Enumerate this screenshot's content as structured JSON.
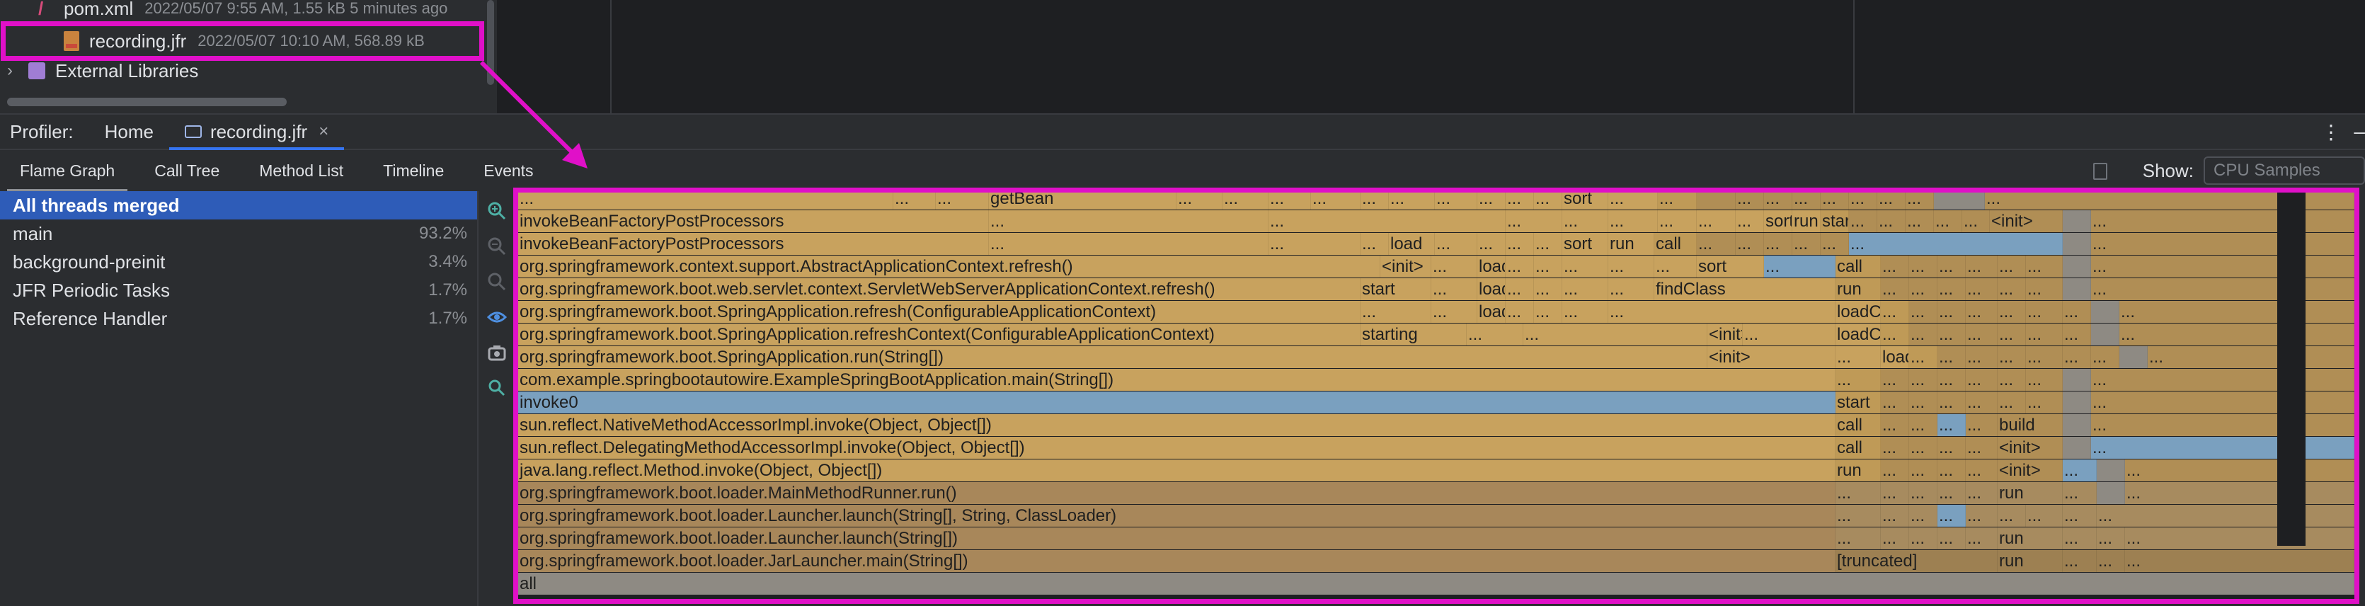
{
  "project_tree": {
    "items": [
      {
        "name": "pom.xml",
        "meta": "2022/05/07 9:55 AM, 1.55 kB 5 minutes ago"
      },
      {
        "name": "recording.jfr",
        "meta": "2022/05/07 10:10 AM, 568.89 kB"
      },
      {
        "name": "External Libraries",
        "meta": ""
      }
    ]
  },
  "profiler": {
    "label": "Profiler:",
    "tabs": [
      {
        "label": "Home"
      },
      {
        "label": "recording.jfr",
        "closable": true
      }
    ],
    "close_glyph": "×",
    "menu_glyph": "⋮",
    "minimize_glyph": "–"
  },
  "sub_tabs": [
    "Flame Graph",
    "Call Tree",
    "Method List",
    "Timeline",
    "Events"
  ],
  "show": {
    "label": "Show:",
    "value": "CPU Samples"
  },
  "threads": [
    {
      "name": "All threads merged",
      "pct": ""
    },
    {
      "name": "main",
      "pct": "93.2%"
    },
    {
      "name": "background-preinit",
      "pct": "3.4%"
    },
    {
      "name": "JFR Periodic Tasks",
      "pct": "1.7%"
    },
    {
      "name": "Reference Handler",
      "pct": "1.7%"
    }
  ],
  "toolbar_icons": [
    "zoom-in-icon",
    "zoom-out-icon",
    "zoom-reset-icon",
    "eye-icon",
    "camera-icon",
    "search-icon"
  ],
  "colors": {
    "highlight": "#e010c8",
    "frame_main": "#c8a25e",
    "frame_selected": "#7aa0bf",
    "frame_root": "#8e8a83",
    "active_tab": "#3574f0",
    "thread_selected": "#2e5cb8"
  },
  "flame_rows": [
    {
      "frames": [
        [
          "...",
          "c1"
        ],
        [
          "...",
          "c1"
        ],
        [
          "...",
          "c1"
        ],
        [
          "getBean",
          "c1"
        ],
        [
          "...",
          "c1"
        ],
        [
          "...",
          "c1"
        ],
        [
          "...",
          "c1"
        ],
        [
          "...",
          "c1"
        ],
        [
          "...",
          "c1"
        ],
        [
          "...",
          "c1"
        ],
        [
          "...",
          "c1"
        ],
        [
          "...",
          "c1"
        ],
        [
          "...",
          "c1"
        ],
        [
          "...",
          "c1"
        ],
        [
          "sort",
          "c1"
        ],
        [
          "...",
          "c1"
        ],
        [
          "...",
          "c2"
        ],
        [
          "",
          "c3"
        ],
        [
          "...",
          "c3"
        ],
        [
          "...",
          "c3"
        ],
        [
          "...",
          "c3"
        ],
        [
          "...",
          "c3"
        ],
        [
          "...",
          "c3"
        ],
        [
          "...",
          "c3"
        ],
        [
          "...",
          "c3"
        ],
        [
          "",
          "c6"
        ],
        [
          "...",
          "c3"
        ]
      ]
    },
    {
      "frames": [
        [
          "invokeBeanFactoryPostProcessors",
          "c1"
        ],
        [
          "...",
          "c1"
        ],
        [
          "...",
          "c1"
        ],
        [
          "...",
          "c1"
        ],
        [
          "...",
          "c1"
        ],
        [
          "...",
          "c1"
        ],
        [
          "...",
          "c1"
        ],
        [
          "...",
          "c1"
        ],
        [
          "...",
          "c1"
        ],
        [
          "sort",
          "c1"
        ],
        [
          "run",
          "c1"
        ],
        [
          "start",
          "c2"
        ],
        [
          "...",
          "c3"
        ],
        [
          "...",
          "c3"
        ],
        [
          "...",
          "c3"
        ],
        [
          "...",
          "c3"
        ],
        [
          "...",
          "c3"
        ],
        [
          "<init>",
          "c3"
        ],
        [
          "",
          "c6"
        ],
        [
          "...",
          "c3"
        ]
      ]
    },
    {
      "frames": [
        [
          "invokeBeanFactoryPostProcessors",
          "c1"
        ],
        [
          "...",
          "c1"
        ],
        [
          "...",
          "c1"
        ],
        [
          "...",
          "c1"
        ],
        [
          "load",
          "c1"
        ],
        [
          "...",
          "c1"
        ],
        [
          "...",
          "c1"
        ],
        [
          "...",
          "c1"
        ],
        [
          "...",
          "c1"
        ],
        [
          "sort",
          "c1"
        ],
        [
          "run",
          "c1"
        ],
        [
          "call",
          "c2"
        ],
        [
          "...",
          "c3"
        ],
        [
          "...",
          "c3"
        ],
        [
          "...",
          "c3"
        ],
        [
          "...",
          "c3"
        ],
        [
          "...",
          "c3"
        ],
        [
          "...",
          "c5"
        ],
        [
          "",
          "c6"
        ],
        [
          "...",
          "c3"
        ]
      ]
    },
    {
      "frames": [
        [
          "org.springframework.context.support.AbstractApplicationContext.refresh()",
          "c1"
        ],
        [
          "<init>",
          "c1"
        ],
        [
          "...",
          "c1"
        ],
        [
          "load",
          "c1"
        ],
        [
          "...",
          "c1"
        ],
        [
          "...",
          "c1"
        ],
        [
          "...",
          "c1"
        ],
        [
          "...",
          "c1"
        ],
        [
          "...",
          "c1"
        ],
        [
          "sort",
          "c1"
        ],
        [
          "...",
          "c5"
        ],
        [
          "call",
          "c2"
        ],
        [
          "...",
          "c3"
        ],
        [
          "...",
          "c3"
        ],
        [
          "...",
          "c3"
        ],
        [
          "...",
          "c3"
        ],
        [
          "...",
          "c3"
        ],
        [
          "...",
          "c3"
        ],
        [
          "",
          "c6"
        ],
        [
          "...",
          "c3"
        ]
      ]
    },
    {
      "frames": [
        [
          "org.springframework.boot.web.servlet.context.ServletWebServerApplicationContext.refresh()",
          "c1"
        ],
        [
          "start",
          "c1"
        ],
        [
          "...",
          "c1"
        ],
        [
          "load",
          "c1"
        ],
        [
          "...",
          "c1"
        ],
        [
          "...",
          "c1"
        ],
        [
          "...",
          "c1"
        ],
        [
          "...",
          "c1"
        ],
        [
          "findClass",
          "c1"
        ],
        [
          "run",
          "c2"
        ],
        [
          "...",
          "c3"
        ],
        [
          "...",
          "c3"
        ],
        [
          "...",
          "c3"
        ],
        [
          "...",
          "c3"
        ],
        [
          "...",
          "c3"
        ],
        [
          "...",
          "c3"
        ],
        [
          "",
          "c6"
        ],
        [
          "...",
          "c3"
        ]
      ]
    },
    {
      "frames": [
        [
          "org.springframework.boot.SpringApplication.refresh(ConfigurableApplicationContext)",
          "c1"
        ],
        [
          "...",
          "c1"
        ],
        [
          "...",
          "c1"
        ],
        [
          "load",
          "c1"
        ],
        [
          "...",
          "c1"
        ],
        [
          "...",
          "c1"
        ],
        [
          "...",
          "c1"
        ],
        [
          "...",
          "c1"
        ],
        [
          "loadClass",
          "c1"
        ],
        [
          "...",
          "c2"
        ],
        [
          "...",
          "c3"
        ],
        [
          "...",
          "c3"
        ],
        [
          "...",
          "c3"
        ],
        [
          "...",
          "c3"
        ],
        [
          "...",
          "c3"
        ],
        [
          "...",
          "c3"
        ],
        [
          "",
          "c6"
        ],
        [
          "...",
          "c3"
        ]
      ]
    },
    {
      "frames": [
        [
          "org.springframework.boot.SpringApplication.refreshContext(ConfigurableApplicationContext)",
          "c1"
        ],
        [
          "starting",
          "c1"
        ],
        [
          "...",
          "c1"
        ],
        [
          "...",
          "c1"
        ],
        [
          "<init>",
          "c1"
        ],
        [
          "...",
          "c1"
        ],
        [
          "loadClass",
          "c1"
        ],
        [
          "...",
          "c2"
        ],
        [
          "...",
          "c3"
        ],
        [
          "...",
          "c3"
        ],
        [
          "...",
          "c3"
        ],
        [
          "...",
          "c3"
        ],
        [
          "...",
          "c3"
        ],
        [
          "...",
          "c3"
        ],
        [
          "",
          "c6"
        ],
        [
          "...",
          "c3"
        ]
      ]
    },
    {
      "frames": [
        [
          "org.springframework.boot.SpringApplication.run(String[])",
          "c1"
        ],
        [
          "<init>",
          "c1"
        ],
        [
          "...",
          "c1"
        ],
        [
          "loadClass",
          "c1"
        ],
        [
          "...",
          "c2"
        ],
        [
          "...",
          "c3"
        ],
        [
          "...",
          "c3"
        ],
        [
          "...",
          "c3"
        ],
        [
          "...",
          "c3"
        ],
        [
          "...",
          "c3"
        ],
        [
          "...",
          "c3"
        ],
        [
          "",
          "c6"
        ],
        [
          "...",
          "c3"
        ]
      ]
    },
    {
      "frames": [
        [
          "com.example.springbootautowire.ExampleSpringBootApplication.main(String[])",
          "c1"
        ],
        [
          "...",
          "c2"
        ],
        [
          "...",
          "c3"
        ],
        [
          "...",
          "c3"
        ],
        [
          "...",
          "c3"
        ],
        [
          "...",
          "c3"
        ],
        [
          "...",
          "c3"
        ],
        [
          "...",
          "c3"
        ],
        [
          "",
          "c6"
        ],
        [
          "...",
          "c3"
        ]
      ]
    },
    {
      "frames": [
        [
          "invoke0",
          "c5"
        ],
        [
          "start",
          "c2"
        ],
        [
          "...",
          "c3"
        ],
        [
          "...",
          "c3"
        ],
        [
          "...",
          "c3"
        ],
        [
          "...",
          "c3"
        ],
        [
          "...",
          "c3"
        ],
        [
          "...",
          "c3"
        ],
        [
          "",
          "c6"
        ],
        [
          "...",
          "c3"
        ]
      ]
    },
    {
      "frames": [
        [
          "sun.reflect.NativeMethodAccessorImpl.invoke(Object, Object[])",
          "c1"
        ],
        [
          "call",
          "c2"
        ],
        [
          "...",
          "c3"
        ],
        [
          "...",
          "c3"
        ],
        [
          "...",
          "c5"
        ],
        [
          "...",
          "c3"
        ],
        [
          "build",
          "c3"
        ],
        [
          "",
          "c6"
        ],
        [
          "...",
          "c3"
        ]
      ]
    },
    {
      "frames": [
        [
          "sun.reflect.DelegatingMethodAccessorImpl.invoke(Object, Object[])",
          "c1"
        ],
        [
          "call",
          "c2"
        ],
        [
          "...",
          "c3"
        ],
        [
          "...",
          "c3"
        ],
        [
          "...",
          "c3"
        ],
        [
          "...",
          "c3"
        ],
        [
          "<init>",
          "c3"
        ],
        [
          "",
          "c6"
        ],
        [
          "...",
          "c5"
        ]
      ]
    },
    {
      "frames": [
        [
          "java.lang.reflect.Method.invoke(Object, Object[])",
          "c1"
        ],
        [
          "run",
          "c2"
        ],
        [
          "...",
          "c3"
        ],
        [
          "...",
          "c3"
        ],
        [
          "...",
          "c3"
        ],
        [
          "...",
          "c3"
        ],
        [
          "<init>",
          "c3"
        ],
        [
          "...",
          "c5"
        ],
        [
          "",
          "c6"
        ],
        [
          "...",
          "c3"
        ]
      ]
    },
    {
      "frames": [
        [
          "org.springframework.boot.loader.MainMethodRunner.run()",
          "c4"
        ],
        [
          "...",
          "c7"
        ],
        [
          "...",
          "c7"
        ],
        [
          "...",
          "c7"
        ],
        [
          "...",
          "c7"
        ],
        [
          "...",
          "c7"
        ],
        [
          "run",
          "c7"
        ],
        [
          "...",
          "c7"
        ],
        [
          "",
          "c6"
        ],
        [
          "...",
          "c7"
        ]
      ]
    },
    {
      "frames": [
        [
          "org.springframework.boot.loader.Launcher.launch(String[], String, ClassLoader)",
          "c4"
        ],
        [
          "...",
          "c7"
        ],
        [
          "...",
          "c7"
        ],
        [
          "...",
          "c7"
        ],
        [
          "...",
          "c5"
        ],
        [
          "...",
          "c7"
        ],
        [
          "...",
          "c7"
        ],
        [
          "...",
          "c7"
        ],
        [
          "...",
          "c7"
        ],
        [
          "...",
          "c7"
        ]
      ]
    },
    {
      "frames": [
        [
          "org.springframework.boot.loader.Launcher.launch(String[])",
          "c4"
        ],
        [
          "...",
          "c7"
        ],
        [
          "...",
          "c7"
        ],
        [
          "...",
          "c7"
        ],
        [
          "...",
          "c7"
        ],
        [
          "...",
          "c7"
        ],
        [
          "run",
          "c7"
        ],
        [
          "...",
          "c7"
        ],
        [
          "...",
          "c7"
        ],
        [
          "...",
          "c7"
        ]
      ]
    },
    {
      "frames": [
        [
          "org.springframework.boot.loader.JarLauncher.main(String[])",
          "c4"
        ],
        [
          "[truncated]",
          "c8"
        ],
        [
          "run",
          "c8"
        ],
        [
          "...",
          "c8"
        ],
        [
          "...",
          "c8"
        ],
        [
          "...",
          "c8"
        ]
      ]
    },
    {
      "frames": [
        [
          "all",
          "c6"
        ]
      ]
    }
  ]
}
